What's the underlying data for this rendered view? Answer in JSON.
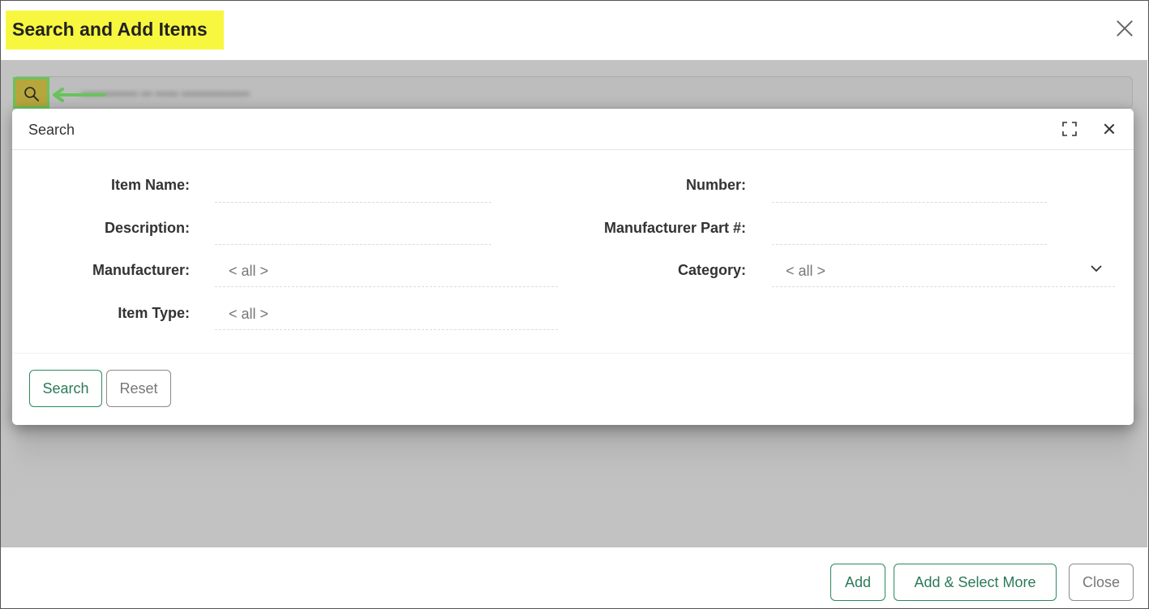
{
  "dialog": {
    "title": "Search and Add Items"
  },
  "searchbar": {
    "text": "... (blurred)"
  },
  "modal": {
    "title": "Search",
    "fields": {
      "item_name_label": "Item Name:",
      "number_label": "Number:",
      "description_label": "Description:",
      "manufacturer_part_label": "Manufacturer Part #:",
      "manufacturer_label": "Manufacturer:",
      "manufacturer_value": "< all >",
      "category_label": "Category:",
      "category_value": "< all >",
      "item_type_label": "Item Type:",
      "item_type_value": "< all >"
    },
    "buttons": {
      "search": "Search",
      "reset": "Reset"
    }
  },
  "footer": {
    "add": "Add",
    "add_select_more": "Add & Select More",
    "close": "Close"
  },
  "colors": {
    "title_highlight": "#f7f740",
    "accent_green": "#2b8a5c",
    "annotation_green": "#69c35d"
  }
}
